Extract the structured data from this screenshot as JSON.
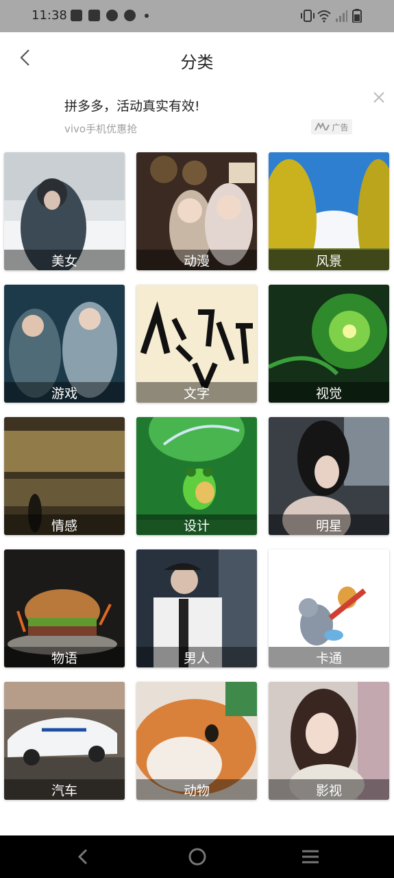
{
  "status_bar": {
    "time": "11:38"
  },
  "header": {
    "title": "分类"
  },
  "ad": {
    "title": "拼多多，活动真实有效!",
    "subtitle": "vivo手机优惠抢",
    "badge": "广告"
  },
  "categories": [
    {
      "label": "美女"
    },
    {
      "label": "动漫"
    },
    {
      "label": "风景"
    },
    {
      "label": "游戏"
    },
    {
      "label": "文字"
    },
    {
      "label": "视觉"
    },
    {
      "label": "情感"
    },
    {
      "label": "设计"
    },
    {
      "label": "明星"
    },
    {
      "label": "物语"
    },
    {
      "label": "男人"
    },
    {
      "label": "卡通"
    },
    {
      "label": "汽车"
    },
    {
      "label": "动物"
    },
    {
      "label": "影视"
    }
  ],
  "colors": {
    "status_bar_bg": "#a9a9a9",
    "nav_bar_bg": "#000000",
    "label_overlay": "rgba(0,0,0,0.42)"
  }
}
